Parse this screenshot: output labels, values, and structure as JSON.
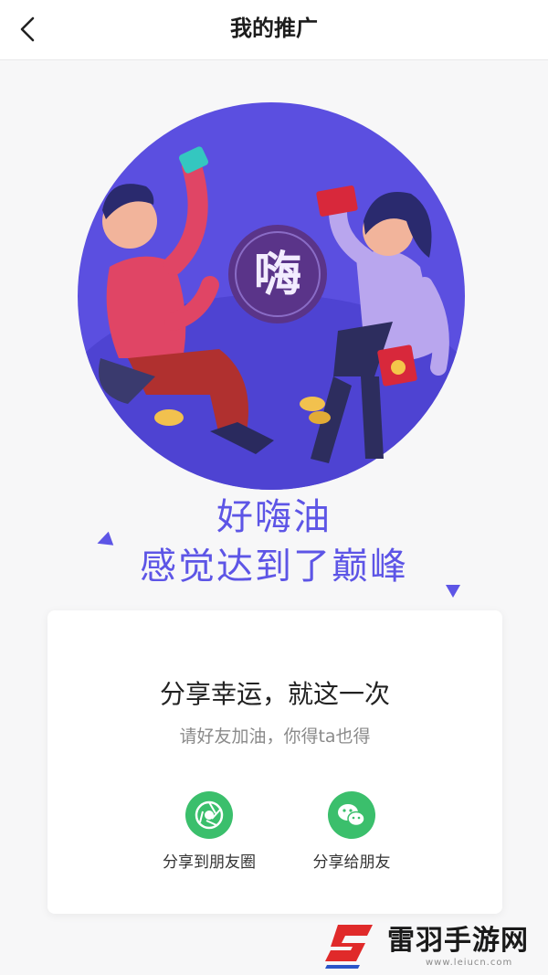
{
  "header": {
    "title": "我的推广",
    "back_icon": "chevron-left-icon"
  },
  "hero": {
    "badge_text": "嗨",
    "slogan_line1": "好嗨油",
    "slogan_line2": "感觉达到了巅峰",
    "accent_color": "#5d55e6",
    "circle_color": "#5b4fe0"
  },
  "card": {
    "title": "分享幸运，就这一次",
    "subtitle": "请好友加油，你得ta也得",
    "share_options": [
      {
        "label": "分享到朋友圈",
        "icon": "moments-shutter-icon"
      },
      {
        "label": "分享给朋友",
        "icon": "wechat-icon"
      }
    ],
    "share_color": "#3bbf6c"
  },
  "watermark": {
    "brand": "雷羽手游网",
    "url": "www.leiucn.com"
  }
}
